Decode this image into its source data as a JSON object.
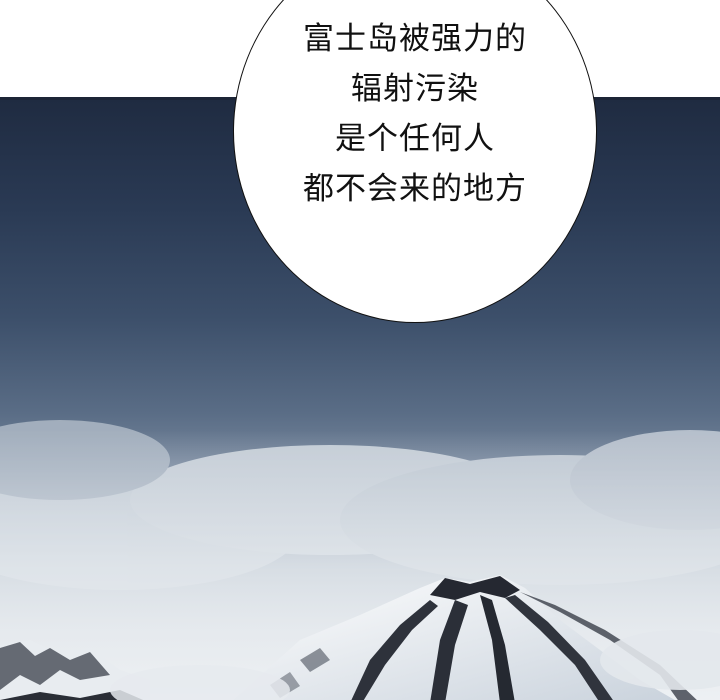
{
  "speech_bubble": {
    "lines": [
      "富士岛被强力的",
      "辐射污染",
      "是个任何人",
      "都不会来的地方"
    ]
  },
  "scene": {
    "sky_top_color": "#1f2b41",
    "sky_mid_color": "#5a6d86",
    "fog_color": "#dfe4e9",
    "snow_color": "#f2f4f6",
    "rock_color": "#1e2128"
  }
}
